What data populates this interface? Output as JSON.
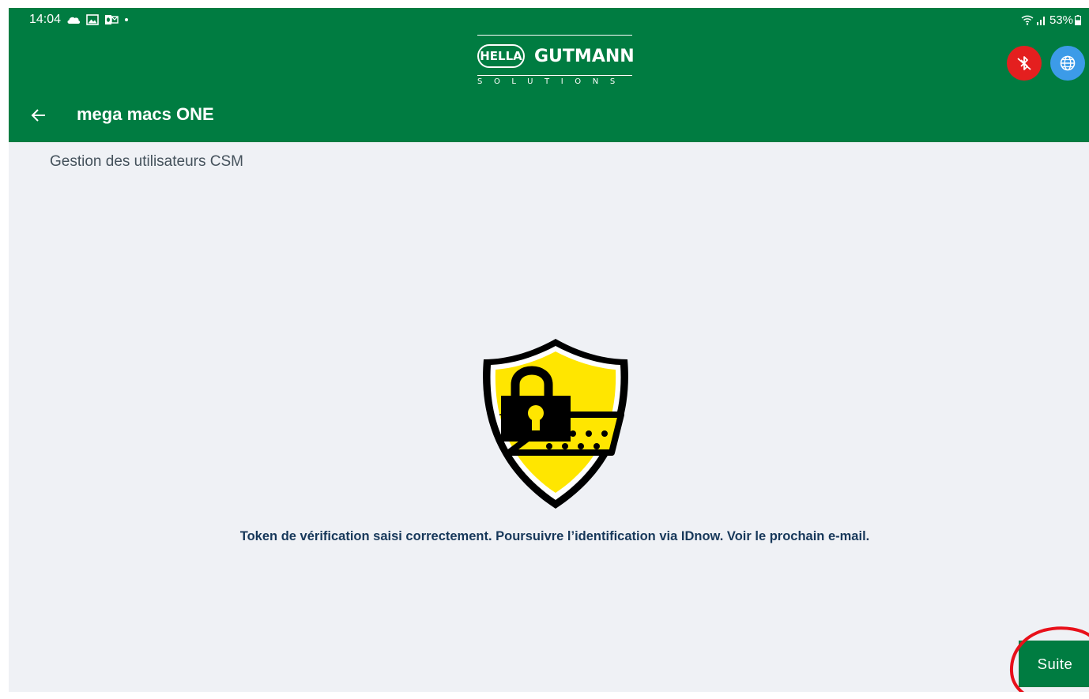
{
  "status_bar": {
    "time": "14:04",
    "left_icons": [
      "cloud-icon",
      "gallery-icon",
      "outlook-icon",
      "dot-icon"
    ],
    "battery": "53%",
    "right_icons": [
      "wifi-icon",
      "signal-icon",
      "battery-icon"
    ]
  },
  "header": {
    "logo_brand": "HELLA",
    "logo_name": "GUTMANN",
    "logo_tagline": "SOLUTIONS",
    "app_title": "mega macs ONE",
    "bluetooth_icon": "bluetooth-disabled-icon",
    "language_icon": "globe-icon",
    "back_icon": "back-arrow-icon"
  },
  "content": {
    "section_title": "Gestion des utilisateurs CSM",
    "illustration": "security-shield-lock-icon",
    "message": "Token de vérification saisi correctement. Poursuivre l’identification via IDnow. Voir le prochain e-mail."
  },
  "actions": {
    "next_label": "Suite"
  },
  "colors": {
    "header_green": "#007c41",
    "background": "#eff1f5",
    "message_text": "#17385a",
    "shield_yellow": "#ffe600",
    "bluetooth_red": "#e41f1f",
    "globe_blue": "#3c9be8",
    "annotation_red": "#e8101a"
  }
}
